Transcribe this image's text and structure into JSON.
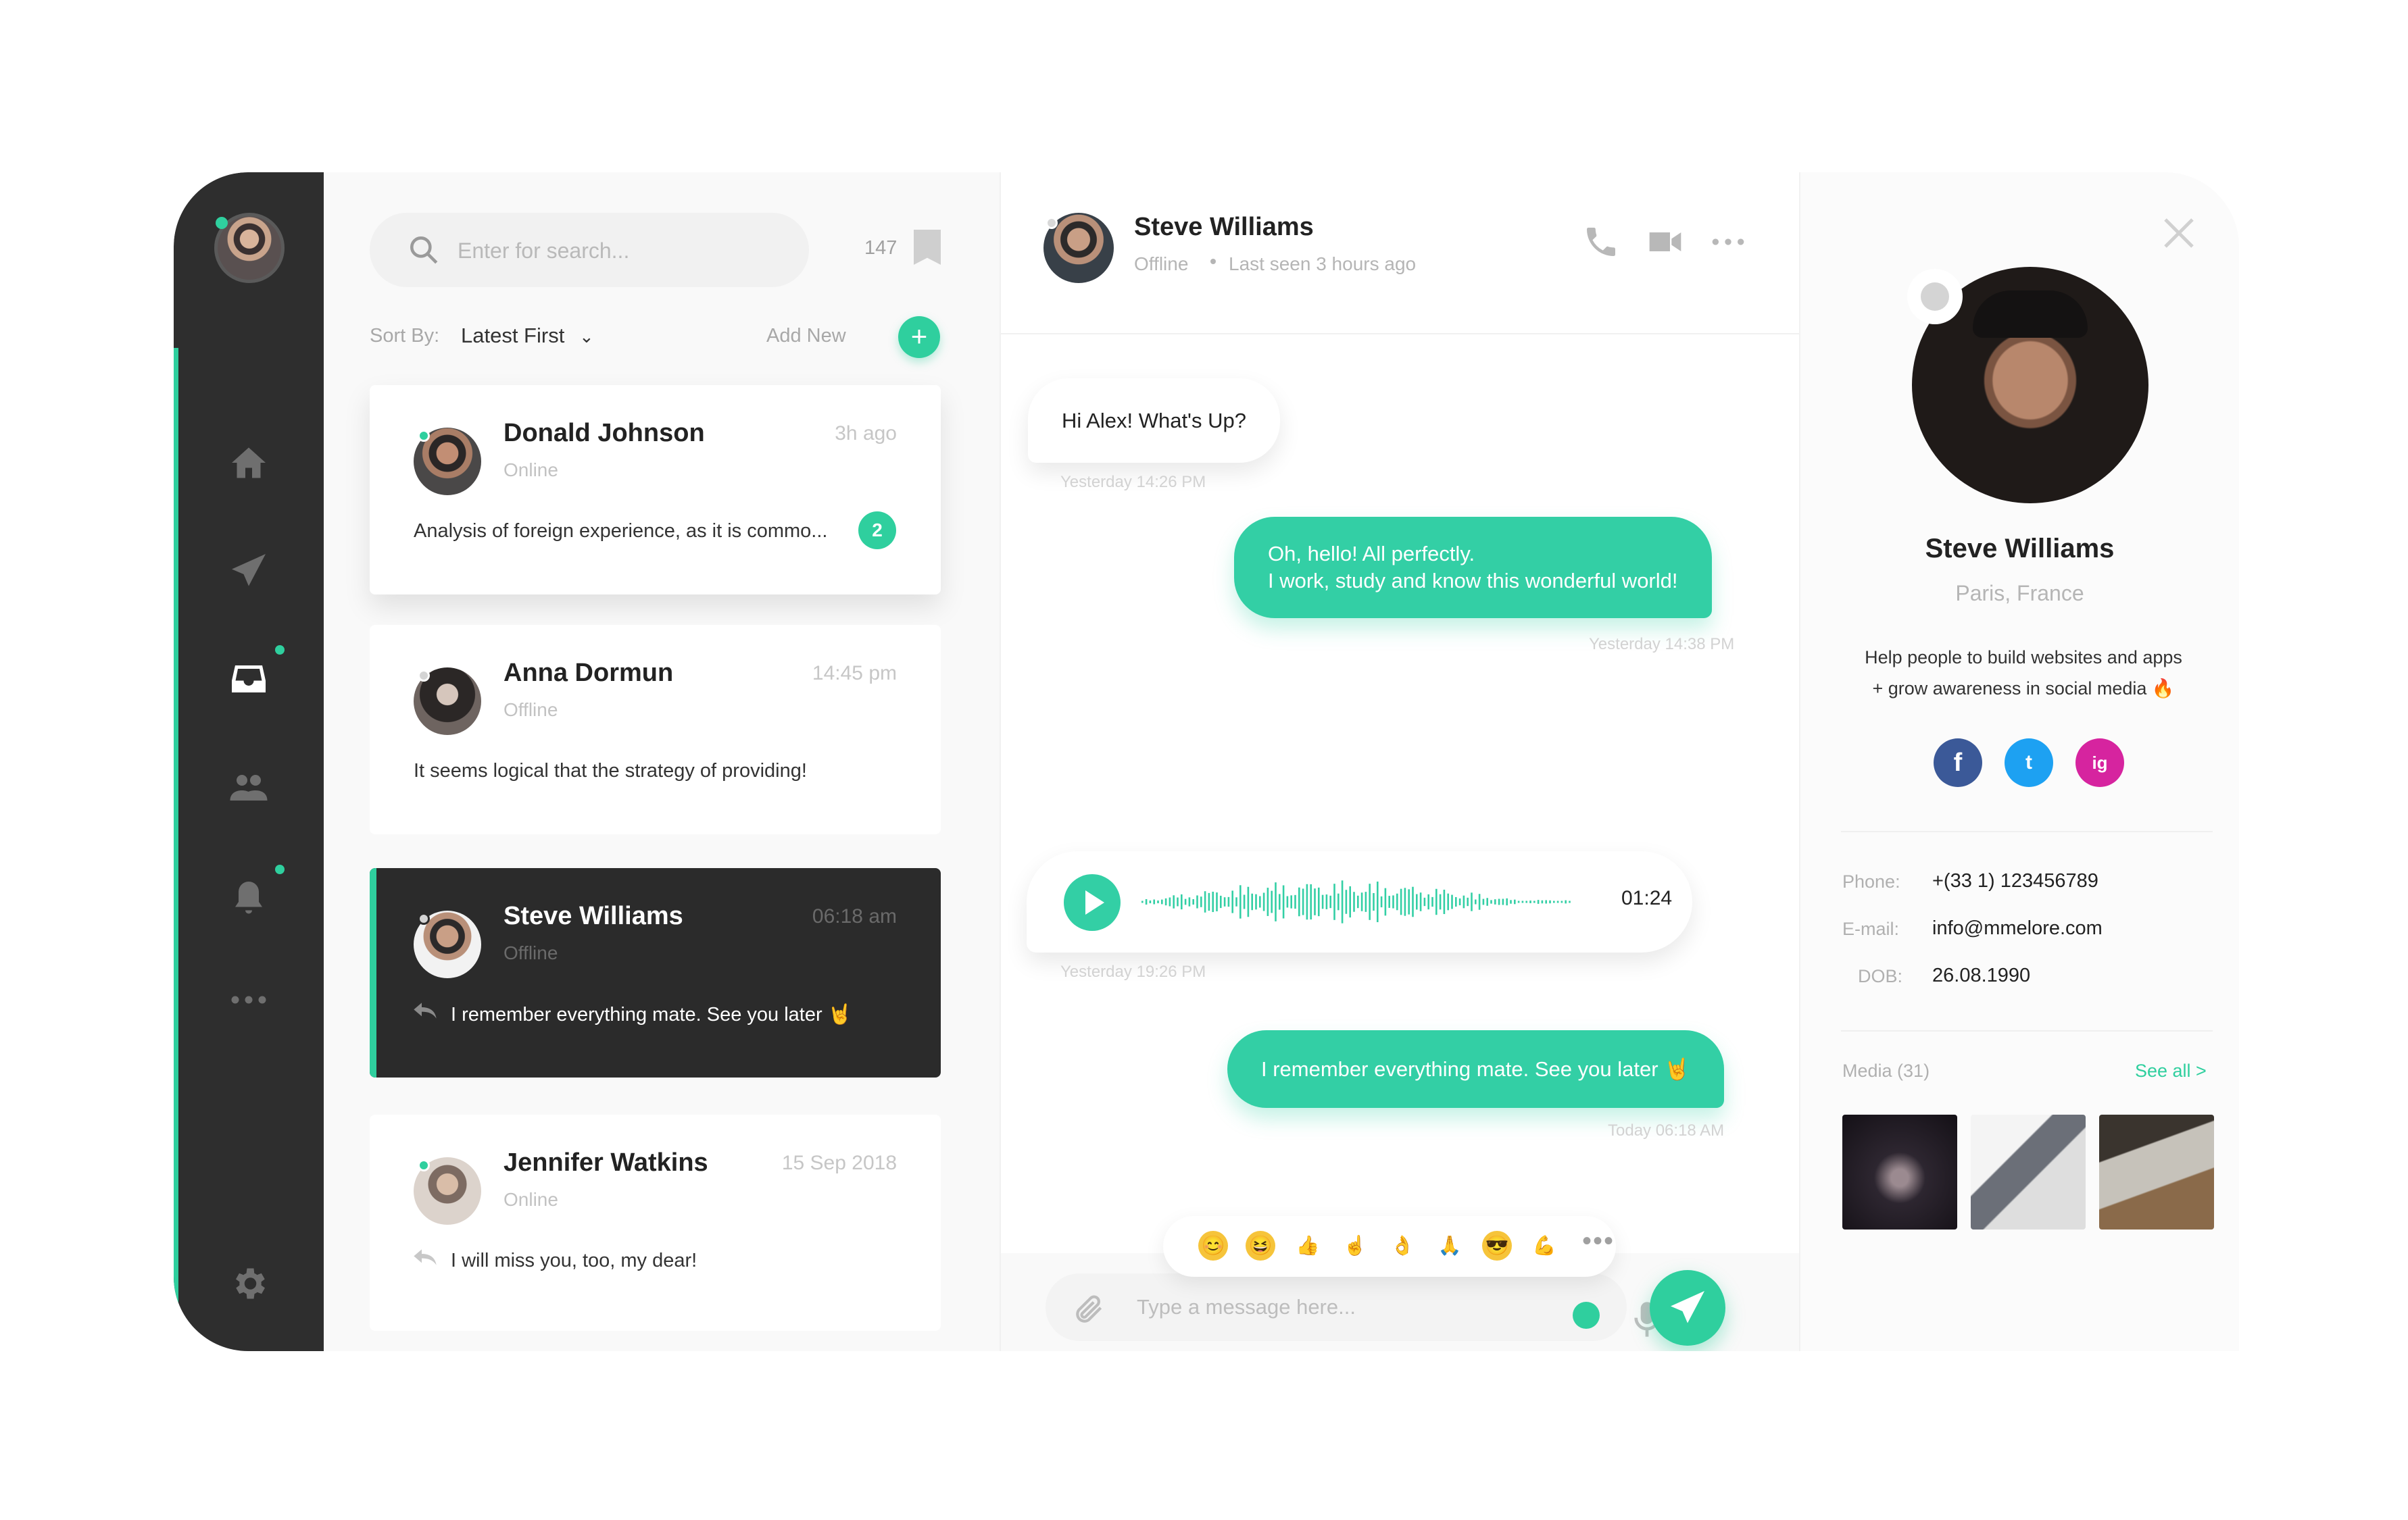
{
  "colors": {
    "accent": "#2fcf9e",
    "nav_bg": "#2e2e2e",
    "active_conv_bg": "#2b2b2b"
  },
  "nav": {
    "avatar_icon": "user-avatar",
    "items": [
      "home-icon",
      "paper-plane-icon",
      "inbox-icon",
      "users-icon",
      "bell-icon",
      "more-icon",
      "gear-icon"
    ]
  },
  "list": {
    "search_placeholder": "Enter for search...",
    "count": "147",
    "sort_label": "Sort By:",
    "sort_value": "Latest First",
    "add_label": "Add New",
    "conversations": [
      {
        "name": "Donald Johnson",
        "status": "Online",
        "time": "3h ago",
        "preview": "Analysis of foreign experience, as it is commo...",
        "unread": "2"
      },
      {
        "name": "Anna Dormun",
        "status": "Offline",
        "time": "14:45 pm",
        "preview": "It seems logical that the strategy of providing!"
      },
      {
        "name": "Steve Williams",
        "status": "Offline",
        "time": "06:18 am",
        "preview": "I remember everything mate. See you later 🤘"
      },
      {
        "name": "Jennifer Watkins",
        "status": "Online",
        "time": "15 Sep 2018",
        "preview": "I will miss you, too, my dear!"
      }
    ]
  },
  "chat": {
    "name": "Steve Williams",
    "status": "Offline",
    "last_seen": "Last seen 3 hours ago",
    "messages": [
      {
        "text": "Hi Alex! What's Up?",
        "time": "Yesterday 14:26 PM"
      },
      {
        "line1": "Oh, hello! All perfectly.",
        "line2": "I work, study and know this wonderful world!",
        "time": "Yesterday 14:38 PM"
      },
      {
        "voice_duration": "01:24",
        "time": "Yesterday 19:26 PM"
      },
      {
        "text": "I remember everything mate. See you later 🤘",
        "time": "Today 06:18 AM"
      }
    ],
    "emojis": [
      "😊",
      "😆",
      "👍",
      "☝",
      "👌",
      "🙏",
      "😎",
      "💪"
    ],
    "composer_placeholder": "Type a message here..."
  },
  "profile": {
    "name": "Steve Williams",
    "location": "Paris, France",
    "bio_line1": "Help people to build websites and apps",
    "bio_line2": "+ grow awareness in social media 🔥",
    "social": [
      {
        "label": "f",
        "color": "#3b5998"
      },
      {
        "label": "t",
        "color": "#1da1f2"
      },
      {
        "label": "ig",
        "color": "#d6249f"
      }
    ],
    "phone_label": "Phone:",
    "phone": "+(33 1) 123456789",
    "email_label": "E-mail:",
    "email": "info@mmelore.com",
    "dob_label": "DOB:",
    "dob": "26.08.1990",
    "media_label": "Media (31)",
    "see_all": "See all >"
  }
}
